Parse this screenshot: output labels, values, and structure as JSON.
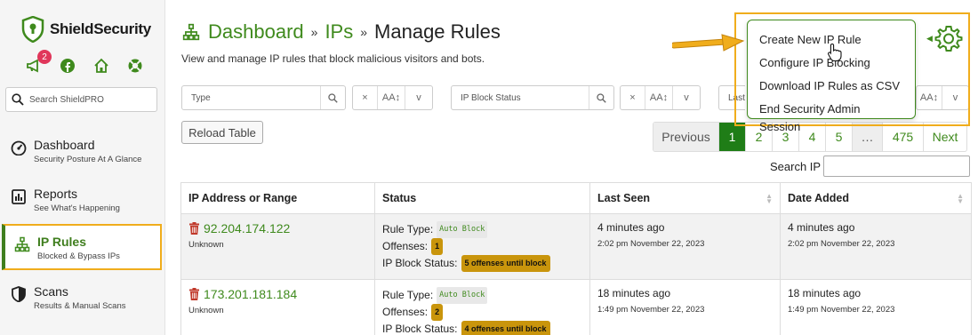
{
  "app": {
    "name": "ShieldSecurity",
    "brand_color": "#3f8a1d",
    "highlight_color": "#f0ad1c"
  },
  "sidebar": {
    "notification_count": "2",
    "search_placeholder": "Search ShieldPRO",
    "items": [
      {
        "label": "Dashboard",
        "sub": "Security Posture At A Glance",
        "icon": "gauge-icon"
      },
      {
        "label": "Reports",
        "sub": "See What's Happening",
        "icon": "report-icon"
      },
      {
        "label": "IP Rules",
        "sub": "Blocked & Bypass IPs",
        "icon": "network-icon",
        "active": true
      },
      {
        "label": "Scans",
        "sub": "Results & Manual Scans",
        "icon": "shield-half-icon"
      }
    ]
  },
  "header": {
    "crumb1": "Dashboard",
    "crumb2": "IPs",
    "sep": "»",
    "current": "Manage Rules",
    "subtitle": "View and manage IP rules that block malicious visitors and bots."
  },
  "filters": {
    "type_placeholder": "Type",
    "status_placeholder": "IP Block Status",
    "last_placeholder": "Last",
    "clear": "×",
    "sort_label": "AA↕",
    "toggle": "v"
  },
  "table_controls": {
    "reload": "Reload Table",
    "pagination": {
      "previous": "Previous",
      "pages": [
        "1",
        "2",
        "3",
        "4",
        "5"
      ],
      "ellipsis": "…",
      "last": "475",
      "next": "Next",
      "current": "1"
    },
    "search_label": "Search IP"
  },
  "table": {
    "columns": [
      "IP Address or Range",
      "Status",
      "Last Seen",
      "Date Added"
    ],
    "rows": [
      {
        "ip": "92.204.174.122",
        "ip_sub": "Unknown",
        "rule_type_label": "Rule Type:",
        "rule_type": "Auto Block",
        "offenses_label": "Offenses:",
        "offenses": "1",
        "block_status_label": "IP Block Status:",
        "block_status": "5 offenses until block",
        "last_seen": "4 minutes ago",
        "last_seen_ts": "2:02 pm November 22, 2023",
        "added": "4 minutes ago",
        "added_ts": "2:02 pm November 22, 2023"
      },
      {
        "ip": "173.201.181.184",
        "ip_sub": "Unknown",
        "rule_type_label": "Rule Type:",
        "rule_type": "Auto Block",
        "offenses_label": "Offenses:",
        "offenses": "2",
        "block_status_label": "IP Block Status:",
        "block_status": "4 offenses until block",
        "last_seen": "18 minutes ago",
        "last_seen_ts": "1:49 pm November 22, 2023",
        "added": "18 minutes ago",
        "added_ts": "1:49 pm November 22, 2023"
      }
    ]
  },
  "dropdown": {
    "items": [
      "Create New IP Rule",
      "Configure IP Blocking",
      "Download IP Rules as CSV",
      "End Security Admin Session"
    ],
    "trigger_icon": "gear-icon"
  }
}
